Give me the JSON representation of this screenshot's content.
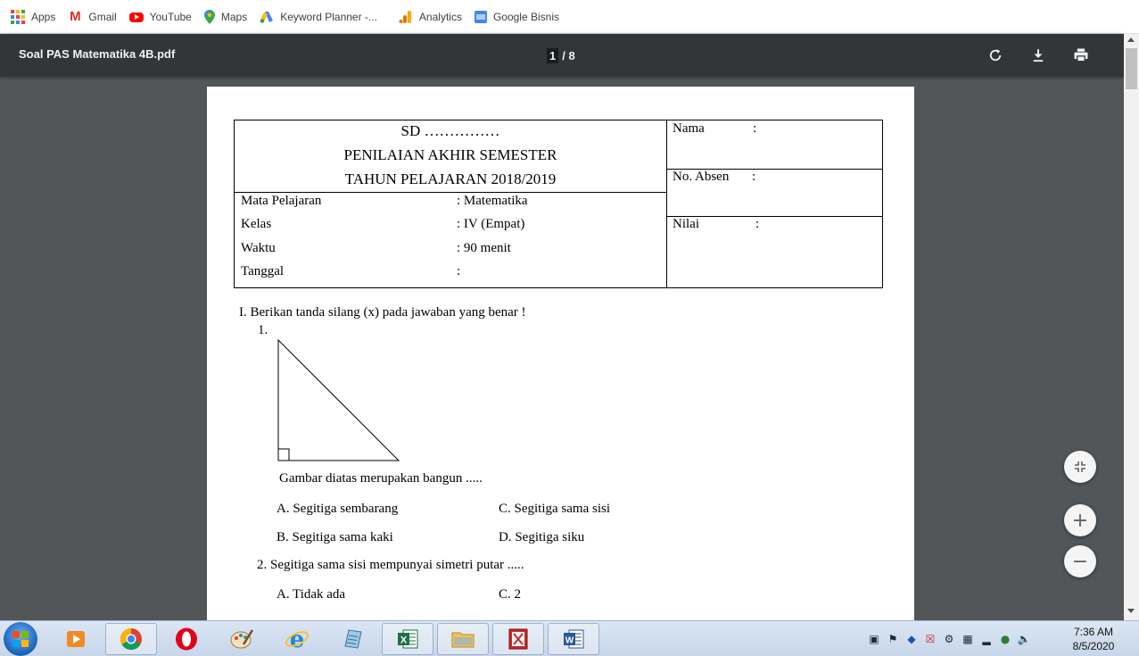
{
  "bookmarks": [
    {
      "label": "Apps",
      "icon": "apps-grid-icon"
    },
    {
      "label": "Gmail",
      "icon": "gmail-icon"
    },
    {
      "label": "YouTube",
      "icon": "youtube-icon"
    },
    {
      "label": "Maps",
      "icon": "maps-pin-icon"
    },
    {
      "label": "Keyword Planner -...",
      "icon": "google-ads-icon"
    },
    {
      "label": "Analytics",
      "icon": "analytics-icon"
    },
    {
      "label": "Google Bisnis",
      "icon": "google-business-icon"
    }
  ],
  "toolbar": {
    "title": "Soal PAS Matematika 4B.pdf",
    "page_current": "1",
    "page_total": "/ 8",
    "rotate_icon": "rotate-icon",
    "download_icon": "download-icon",
    "print_icon": "print-icon"
  },
  "document": {
    "header": {
      "school": "SD ……………",
      "exam_title": "PENILAIAN AKHIR SEMESTER",
      "year": "TAHUN PELAJARAN 2018/2019",
      "fields": [
        {
          "label": "Mata Pelajaran",
          "value": ": Matematika"
        },
        {
          "label": "Kelas",
          "value": ": IV (Empat)"
        },
        {
          "label": "Waktu",
          "value": ": 90 menit"
        },
        {
          "label": "Tanggal",
          "value": ":"
        }
      ],
      "right_fields": [
        {
          "label": "Nama",
          "value": ":"
        },
        {
          "label": "No. Absen",
          "value": ":"
        },
        {
          "label": "Nilai",
          "value": ":"
        }
      ]
    },
    "section_title": "I.  Berikan tanda silang (x) pada jawaban yang benar !",
    "q1": {
      "number": "1.",
      "prompt": "Gambar diatas merupakan bangun .....",
      "options": [
        "A.  Segitiga sembarang",
        "C.  Segitiga sama sisi",
        "B.  Segitiga sama kaki",
        "D.  Segitiga siku"
      ]
    },
    "q2": {
      "prompt": "2.   Segitiga sama sisi mempunyai simetri putar .....",
      "options": [
        "A.  Tidak ada",
        "C.  2"
      ]
    }
  },
  "zoom": {
    "fit_icon": "fit-to-page-icon",
    "zoom_in": "+",
    "zoom_out": "−"
  },
  "taskbar": {
    "apps": [
      "windows-start-icon",
      "media-player-icon",
      "chrome-icon",
      "opera-icon",
      "paint-icon",
      "internet-explorer-icon",
      "notepad-icon",
      "excel-icon",
      "file-explorer-icon",
      "pdf-reader-icon",
      "word-icon"
    ],
    "time": "7:36 AM",
    "date": "8/5/2020"
  }
}
